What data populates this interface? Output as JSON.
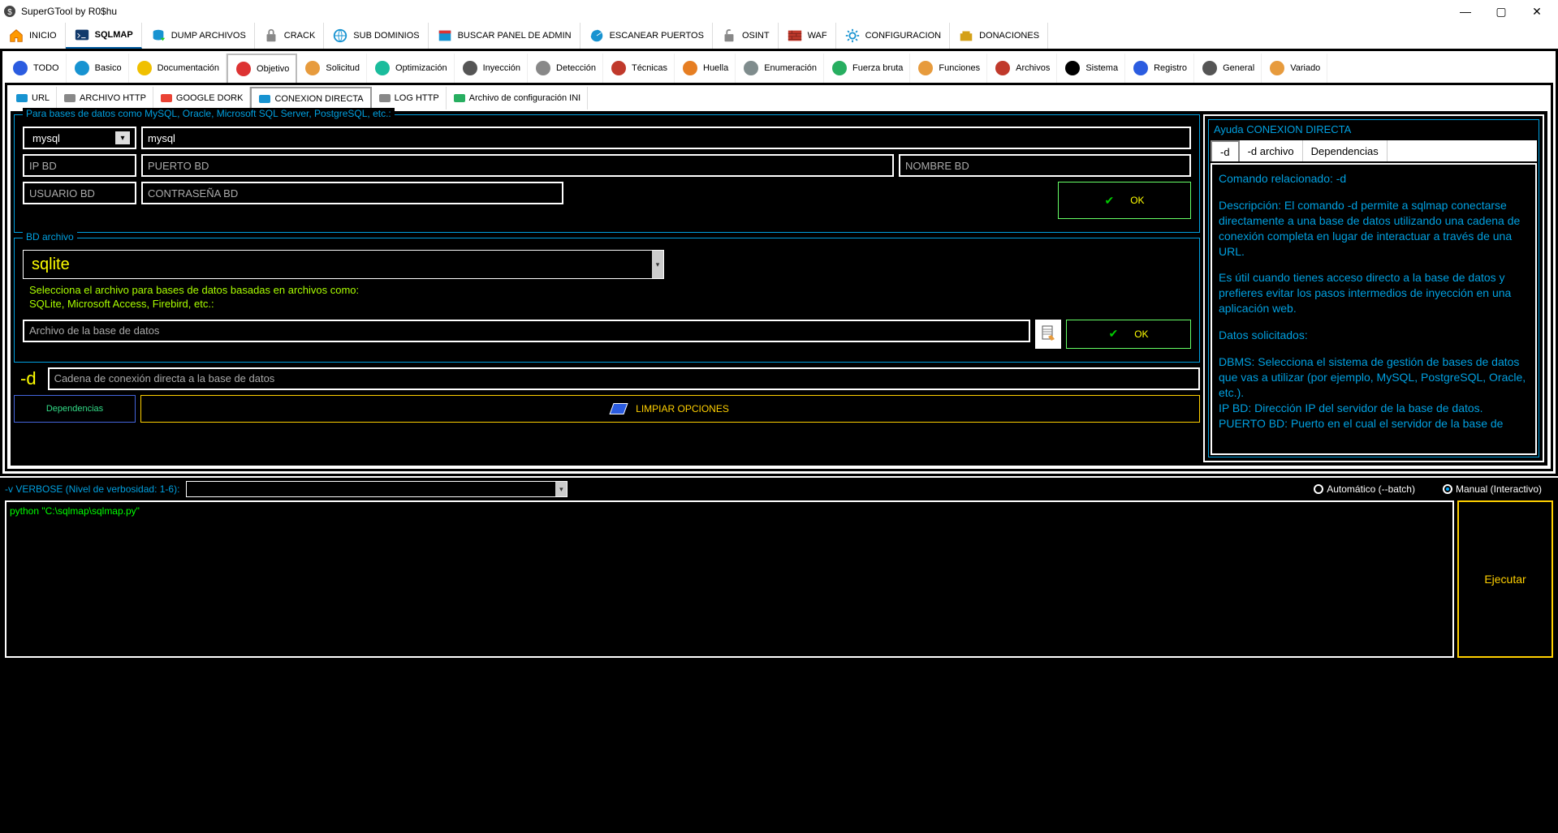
{
  "window": {
    "title": "SuperGTool by R0$hu"
  },
  "main_tabs": [
    {
      "id": "inicio",
      "label": "INICIO",
      "icon": "home"
    },
    {
      "id": "sqlmap",
      "label": "SQLMAP",
      "icon": "terminal",
      "active": true
    },
    {
      "id": "dump",
      "label": "DUMP ARCHIVOS",
      "icon": "dump"
    },
    {
      "id": "crack",
      "label": "CRACK",
      "icon": "lock"
    },
    {
      "id": "subdom",
      "label": "SUB DOMINIOS",
      "icon": "globe"
    },
    {
      "id": "admin",
      "label": "BUSCAR PANEL DE ADMIN",
      "icon": "panel"
    },
    {
      "id": "scan",
      "label": "ESCANEAR PUERTOS",
      "icon": "scan"
    },
    {
      "id": "osint",
      "label": "OSINT",
      "icon": "unlock"
    },
    {
      "id": "waf",
      "label": "WAF",
      "icon": "wall"
    },
    {
      "id": "config",
      "label": "CONFIGURACION",
      "icon": "gear"
    },
    {
      "id": "donate",
      "label": "DONACIONES",
      "icon": "donate"
    }
  ],
  "toolbar": [
    {
      "id": "todo",
      "label": "TODO"
    },
    {
      "id": "basico",
      "label": "Basico"
    },
    {
      "id": "doc",
      "label": "Documentación"
    },
    {
      "id": "objetivo",
      "label": "Objetivo",
      "active": true
    },
    {
      "id": "solicitud",
      "label": "Solicitud"
    },
    {
      "id": "opt",
      "label": "Optimización"
    },
    {
      "id": "inyeccion",
      "label": "Inyección"
    },
    {
      "id": "deteccion",
      "label": "Detección"
    },
    {
      "id": "tecnicas",
      "label": "Técnicas"
    },
    {
      "id": "huella",
      "label": "Huella"
    },
    {
      "id": "enum",
      "label": "Enumeración"
    },
    {
      "id": "fuerza",
      "label": "Fuerza bruta"
    },
    {
      "id": "funciones",
      "label": "Funciones"
    },
    {
      "id": "archivos",
      "label": "Archivos"
    },
    {
      "id": "sistema",
      "label": "Sistema"
    },
    {
      "id": "registro",
      "label": "Registro"
    },
    {
      "id": "general",
      "label": "General"
    },
    {
      "id": "variado",
      "label": "Variado"
    }
  ],
  "subtabs": [
    {
      "id": "url",
      "label": "URL"
    },
    {
      "id": "ahttp",
      "label": "ARCHIVO HTTP"
    },
    {
      "id": "gdork",
      "label": "GOOGLE DORK"
    },
    {
      "id": "conexion",
      "label": "CONEXION DIRECTA",
      "active": true
    },
    {
      "id": "loghttp",
      "label": "LOG HTTP"
    },
    {
      "id": "ini",
      "label": "Archivo de configuración INI"
    }
  ],
  "group1": {
    "legend": "Para bases de datos como MySQL, Oracle, Microsoft SQL Server, PostgreSQL, etc.:",
    "dbms_value": "mysql",
    "dbms_input": "mysql",
    "ip_ph": "IP BD",
    "port_ph": "PUERTO BD",
    "name_ph": "NOMBRE BD",
    "user_ph": "USUARIO BD",
    "pass_ph": "CONTRASEÑA BD",
    "ok": "OK"
  },
  "group2": {
    "legend": "BD archivo",
    "combo_value": "sqlite",
    "help1": "Selecciona el archivo para bases de datos basadas en archivos como:",
    "help2": "SQLite, Microsoft Access, Firebird, etc.:",
    "file_ph": "Archivo de la base de datos",
    "ok": "OK"
  },
  "d_row": {
    "label": "-d",
    "ph": "Cadena de conexión directa a la base de datos"
  },
  "buttons": {
    "dep": "Dependencias",
    "clear": "LIMPIAR OPCIONES"
  },
  "help": {
    "title": "Ayuda CONEXION DIRECTA",
    "tabs": [
      "-d",
      "-d archivo",
      "Dependencias"
    ],
    "body_p1": "Comando relacionado: -d",
    "body_p2": "Descripción: El comando -d permite a sqlmap conectarse directamente a una base de datos utilizando una cadena de conexión completa en lugar de interactuar a través de una URL.",
    "body_p3": "Es útil cuando tienes acceso directo a la base de datos y prefieres evitar los pasos intermedios de inyección en una aplicación web.",
    "body_p4": "Datos solicitados:",
    "body_p5": "DBMS: Selecciona el sistema de gestión de bases de datos que vas a utilizar (por ejemplo, MySQL, PostgreSQL, Oracle, etc.).\nIP BD: Dirección IP del servidor de la base de datos.\nPUERTO BD: Puerto en el cual el servidor de la base de"
  },
  "bottom": {
    "verbose_label": "-v VERBOSE (Nivel de verbosidad: 1-6):",
    "radio_auto": "Automático (--batch)",
    "radio_manual": "Manual (Interactivo)",
    "manual_selected": true
  },
  "console": {
    "line": "python \"C:\\sqlmap\\sqlmap.py\""
  },
  "exec": {
    "label": "Ejecutar"
  }
}
